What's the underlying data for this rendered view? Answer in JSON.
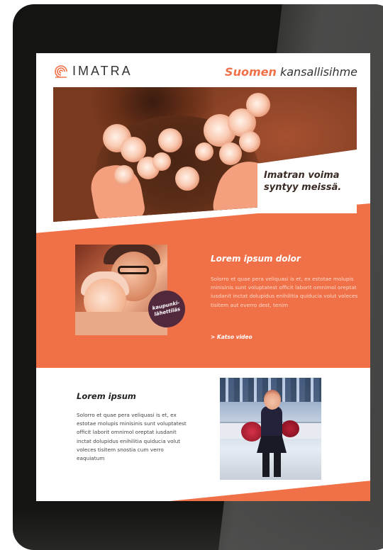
{
  "header": {
    "logo_text": "IMATRA",
    "tagline_accent": "Suomen",
    "tagline_rest": " kansallisihme"
  },
  "hero": {
    "caption_line1": "Imatran voima",
    "caption_line2": "syntyy  meissä."
  },
  "section1": {
    "badge_line1": "kaupunki-",
    "badge_line2": "lähettiläs",
    "title": "Lorem ipsum dolor",
    "body": "Solorro et quae pera veliquasi is et, ex estotae molupis minisinis sunt voluptatest officit laborit omnimol oreptat iusdanit inctat dolupidus enihilitia quiducia volut voleces tisitem aut everro dest, tenim",
    "link": "> Katso video"
  },
  "section2": {
    "title": "Lorem ipsum",
    "body": "Solorro et quae pera veliquasi is et, ex estotae molupis minisinis sunt voluptatest officit laborit omnimol oreptat iusdanit inctat dolupidus enihilitia quiducia volut voleces tisitem snostia cum verro eaquiatum"
  },
  "colors": {
    "accent": "#f07048",
    "badge": "#52283c",
    "device": "#141412"
  },
  "icons": {
    "logo": "imatra-spiral-logo-icon"
  }
}
